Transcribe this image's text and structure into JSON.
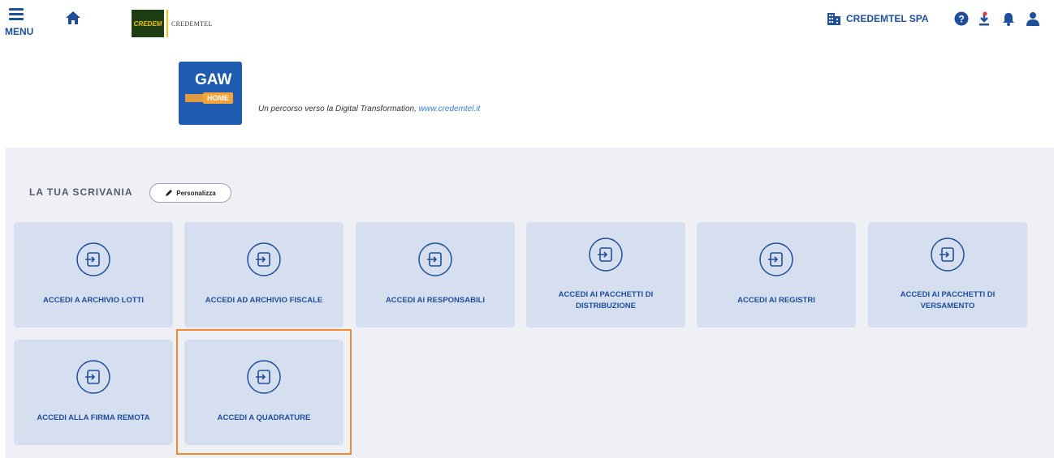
{
  "header": {
    "menu_label": "MENU",
    "brand_badge": "CREDEM",
    "brand_name": "CREDEMTEL",
    "company_name": "CREDEMTEL SPA",
    "icons": [
      "menu-icon",
      "home-icon",
      "building-icon",
      "help-icon",
      "download-icon",
      "bell-icon",
      "user-icon"
    ]
  },
  "hero": {
    "logo_text": "GAW",
    "logo_sub": "HOME",
    "tagline_prefix": "Un percorso verso la Digital Transformation, ",
    "tagline_link": "www.credemtel.it"
  },
  "desk": {
    "title": "LA TUA SCRIVANIA",
    "personalize_label": "Personalizza",
    "tiles": [
      {
        "label": "ACCEDI A ARCHIVIO LOTTI"
      },
      {
        "label": "ACCEDI AD ARCHIVIO FISCALE"
      },
      {
        "label": "ACCEDI AI RESPONSABILI"
      },
      {
        "label": "ACCEDI AI PACCHETTI DI DISTRIBUZIONE"
      },
      {
        "label": "ACCEDI AI REGISTRI"
      },
      {
        "label": "ACCEDI AI PACCHETTI DI VERSAMENTO"
      },
      {
        "label": "ACCEDI ALLA FIRMA REMOTA"
      },
      {
        "label": "ACCEDI A QUADRATURE"
      }
    ]
  },
  "colors": {
    "primary": "#1f4e9a",
    "tile_bg": "#d5dff0",
    "desk_bg": "#eef0f6",
    "highlight": "#f28a30",
    "notification_dot": "#e53935"
  }
}
